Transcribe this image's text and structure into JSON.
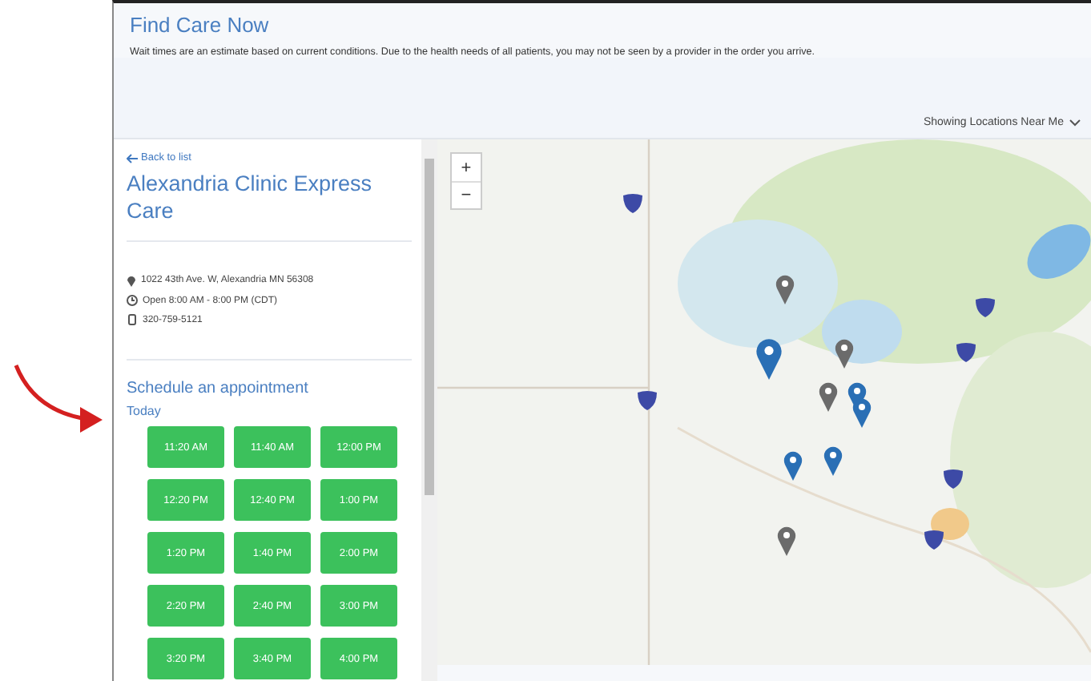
{
  "header": {
    "title": "Find Care Now",
    "notice": "Wait times are an estimate based on current conditions. Due to the health needs of all patients, you may not be seen by a provider in the order you arrive."
  },
  "location_filter": {
    "label": "Showing Locations Near Me"
  },
  "clinic": {
    "back_link": "Back to list",
    "name": "Alexandria Clinic Express Care",
    "address": "1022 43th Ave. W, Alexandria MN 56308",
    "hours": "Open 8:00 AM - 8:00 PM (CDT)",
    "phone": "320-759-5121"
  },
  "schedule": {
    "heading": "Schedule an appointment",
    "day": "Today",
    "slots": [
      "11:20 AM",
      "11:40 AM",
      "12:00 PM",
      "12:20 PM",
      "12:40 PM",
      "1:00 PM",
      "1:20 PM",
      "1:40 PM",
      "2:00 PM",
      "2:20 PM",
      "2:40 PM",
      "3:00 PM",
      "3:20 PM",
      "3:40 PM",
      "4:00 PM"
    ]
  },
  "map": {
    "zoom_in": "+",
    "zoom_out": "−",
    "pins": [
      {
        "color": "#6b6b6b"
      },
      {
        "color": "#2a6fb5"
      },
      {
        "color": "#6b6b6b"
      },
      {
        "color": "#6b6b6b"
      },
      {
        "color": "#2a6fb5"
      },
      {
        "color": "#2a6fb5"
      },
      {
        "color": "#2a6fb5"
      },
      {
        "color": "#2a6fb5"
      },
      {
        "color": "#6b6b6b"
      }
    ]
  }
}
